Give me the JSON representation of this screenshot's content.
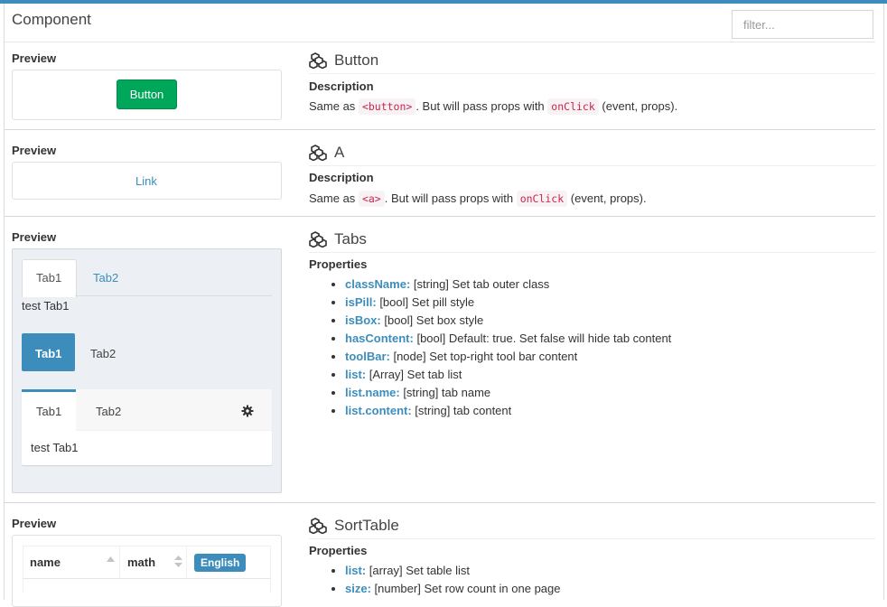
{
  "app": {
    "title": "Component",
    "filter_placeholder": "filter..."
  },
  "sections": [
    {
      "preview_label": "Preview",
      "name": "Button",
      "heading": "Description",
      "desc_before": "Same as",
      "desc_code": "<button>",
      "desc_mid": ". But will pass props with",
      "desc_code2": "onClick",
      "desc_after": "(event, props).",
      "demo_label": "Button"
    },
    {
      "preview_label": "Preview",
      "name": "A",
      "heading": "Description",
      "desc_before": "Same as",
      "desc_code": "<a>",
      "desc_mid": ". But will pass props with",
      "desc_code2": "onClick",
      "desc_after": "(event, props).",
      "demo_label": "Link"
    },
    {
      "preview_label": "Preview",
      "name": "Tabs",
      "heading": "Properties",
      "props": [
        {
          "key": "className:",
          "text": "[string] Set tab outer class"
        },
        {
          "key": "isPill:",
          "text": "[bool] Set pill style"
        },
        {
          "key": "isBox:",
          "text": "[bool] Set box style"
        },
        {
          "key": "hasContent:",
          "text": "[bool] Default: true. Set false will hide tab content"
        },
        {
          "key": "toolBar:",
          "text": "[node] Set top-right tool bar content"
        },
        {
          "key": "list:",
          "text": "[Array] Set tab list"
        },
        {
          "key": "list.name:",
          "text": "[string] tab name"
        },
        {
          "key": "list.content:",
          "text": "[string] tab content"
        }
      ],
      "demo": {
        "tab1": "Tab1",
        "tab2": "Tab2",
        "content": "test Tab1"
      }
    },
    {
      "preview_label": "Preview",
      "name": "SortTable",
      "heading": "Properties",
      "props": [
        {
          "key": "list:",
          "text": "[array] Set table list"
        },
        {
          "key": "size:",
          "text": "[number] Set row count in one page"
        }
      ],
      "demo": {
        "columns": [
          "name",
          "math",
          "English"
        ]
      }
    }
  ],
  "colors": {
    "accent": "#3c8dbc",
    "green": "#00a65a"
  }
}
